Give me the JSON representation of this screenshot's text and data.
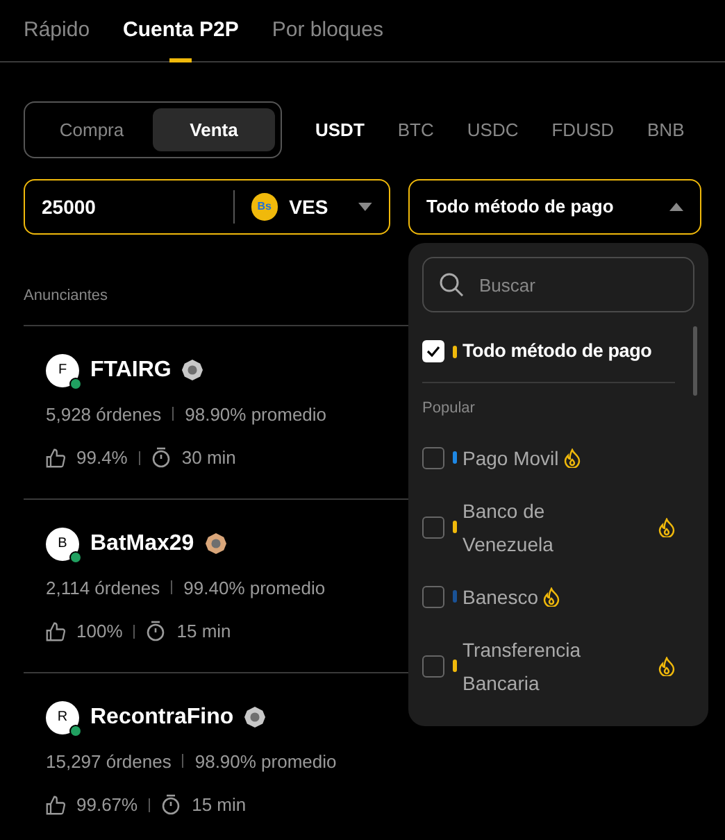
{
  "tabs": [
    {
      "label": "Rápido",
      "selected": false
    },
    {
      "label": "Cuenta P2P",
      "selected": true
    },
    {
      "label": "Por bloques",
      "selected": false
    }
  ],
  "trade_side": [
    {
      "label": "Compra",
      "selected": false
    },
    {
      "label": "Venta",
      "selected": true
    }
  ],
  "assets": [
    {
      "label": "USDT",
      "selected": true
    },
    {
      "label": "BTC",
      "selected": false
    },
    {
      "label": "USDC",
      "selected": false
    },
    {
      "label": "FDUSD",
      "selected": false
    },
    {
      "label": "BNB",
      "selected": false
    }
  ],
  "amount": {
    "value": "25000",
    "currency_symbol": "Bs",
    "currency": "VES"
  },
  "payment_filter": {
    "value": "Todo método de pago",
    "expanded": true
  },
  "list_header": "Anunciantes",
  "advertisers": [
    {
      "initial": "F",
      "name": "FTAIRG",
      "color": "#c8c8c8",
      "orders": "5,928 órdenes",
      "completion": "98.90% promedio",
      "rating": "99.4%",
      "time": "30 min"
    },
    {
      "initial": "B",
      "name": "BatMax29",
      "color": "#d9a67a",
      "orders": "2,114 órdenes",
      "completion": "99.40% promedio",
      "rating": "100%",
      "time": "15 min"
    },
    {
      "initial": "R",
      "name": "RecontraFino",
      "color": "#c8c8c8",
      "orders": "15,297 órdenes",
      "completion": "98.90% promedio",
      "rating": "99.67%",
      "time": "15 min"
    }
  ],
  "payment_menu": {
    "search_placeholder": "Buscar",
    "all": {
      "label": "Todo método de pago",
      "checked": true,
      "color": "#f0b90b"
    },
    "section": "Popular",
    "methods": [
      {
        "label": "Pago Movil",
        "checked": false,
        "color": "#1e88e5",
        "hot": true
      },
      {
        "label": "Banco de Venezuela",
        "checked": false,
        "color": "#f0b90b",
        "hot": true
      },
      {
        "label": "Banesco",
        "checked": false,
        "color": "#1a5296",
        "hot": true
      },
      {
        "label": "Transferencia Bancaria",
        "checked": false,
        "color": "#f0b90b",
        "hot": true
      }
    ]
  }
}
